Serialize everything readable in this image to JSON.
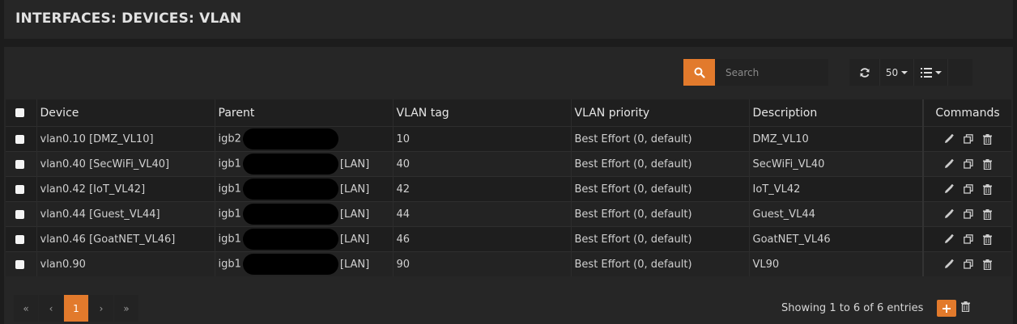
{
  "page": {
    "title": "INTERFACES: DEVICES: VLAN"
  },
  "toolbar": {
    "search_placeholder": "Search",
    "page_size": "50",
    "icons": [
      "search-icon",
      "refresh-icon",
      "columns-list-icon"
    ]
  },
  "table": {
    "columns": [
      "Device",
      "Parent",
      "VLAN tag",
      "VLAN priority",
      "Description",
      "Commands"
    ],
    "rows": [
      {
        "device": "vlan0.10 [DMZ_VL10]",
        "parent": "igb2",
        "parent_tag": "",
        "tag": "10",
        "priority": "Best Effort (0, default)",
        "description": "DMZ_VL10"
      },
      {
        "device": "vlan0.40 [SecWiFi_VL40]",
        "parent": "igb1",
        "parent_tag": "[LAN]",
        "tag": "40",
        "priority": "Best Effort (0, default)",
        "description": "SecWiFi_VL40"
      },
      {
        "device": "vlan0.42 [IoT_VL42]",
        "parent": "igb1",
        "parent_tag": "[LAN]",
        "tag": "42",
        "priority": "Best Effort (0, default)",
        "description": "IoT_VL42"
      },
      {
        "device": "vlan0.44 [Guest_VL44]",
        "parent": "igb1",
        "parent_tag": "[LAN]",
        "tag": "44",
        "priority": "Best Effort (0, default)",
        "description": "Guest_VL44"
      },
      {
        "device": "vlan0.46 [GoatNET_VL46]",
        "parent": "igb1",
        "parent_tag": "[LAN]",
        "tag": "46",
        "priority": "Best Effort (0, default)",
        "description": "GoatNET_VL46"
      },
      {
        "device": "vlan0.90",
        "parent": "igb1",
        "parent_tag": "[LAN]",
        "tag": "90",
        "priority": "Best Effort (0, default)",
        "description": "VL90"
      }
    ]
  },
  "pagination": {
    "first": "«",
    "prev": "‹",
    "current": "1",
    "next": "›",
    "last": "»",
    "info": "Showing 1 to 6 of 6 entries"
  },
  "colors": {
    "accent": "#e27a2c",
    "background": "#1c1c1c",
    "panel": "#262626"
  }
}
